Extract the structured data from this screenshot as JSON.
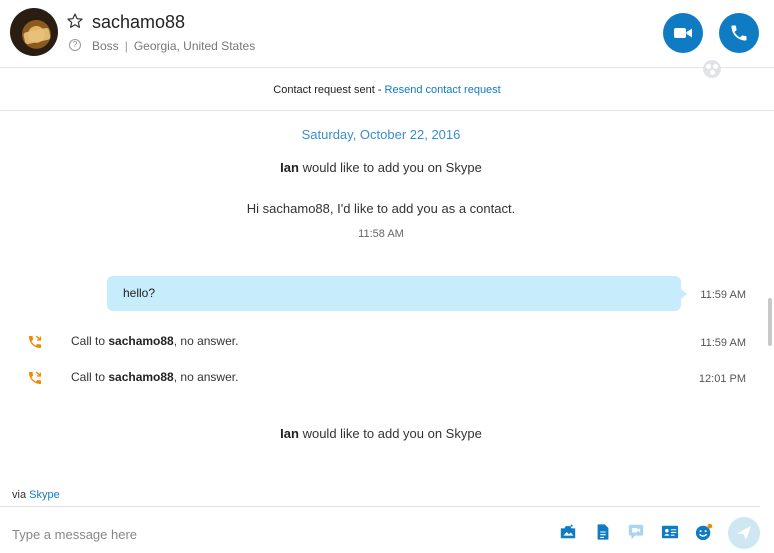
{
  "header": {
    "contact_name": "sachamo88",
    "mood": "Boss",
    "location": "Georgia, United States",
    "question_mark": "?",
    "separator": "|"
  },
  "request_bar": {
    "text": "Contact request sent - ",
    "resend_label": "Resend contact request"
  },
  "conversation": {
    "date": "Saturday, October 22, 2016",
    "add_request_1": {
      "name": "Ian",
      "text": " would like to add you on Skype"
    },
    "contact_message": "Hi sachamo88, I'd like to add you as a contact.",
    "contact_message_time": "11:58 AM",
    "bubble": {
      "text": "hello?",
      "time": "11:59 AM"
    },
    "calls": [
      {
        "prefix": "Call to ",
        "name": "sachamo88",
        "suffix": ", no answer.",
        "time": "11:59 AM"
      },
      {
        "prefix": "Call to ",
        "name": "sachamo88",
        "suffix": ", no answer.",
        "time": "12:01 PM"
      }
    ],
    "add_request_2": {
      "name": "Ian",
      "text": " would like to add you on Skype"
    }
  },
  "composer": {
    "via_prefix": "via ",
    "via_link": "Skype",
    "placeholder": "Type a message here"
  },
  "icons": {
    "favorite": "star-outline-icon",
    "video": "video-camera-icon",
    "call": "phone-icon",
    "participants": "people-icon",
    "missed_call": "missed-call-icon",
    "send_image": "image-icon",
    "send_file": "file-icon",
    "video_message": "video-message-icon",
    "send_contact": "contact-card-icon",
    "emoticon": "emoticon-icon",
    "send": "send-arrow-icon"
  },
  "colors": {
    "accent": "#0f7bc2",
    "bubble": "#c7ecfb",
    "missed_call": "#f08a00",
    "date_text": "#3a8fc8"
  }
}
